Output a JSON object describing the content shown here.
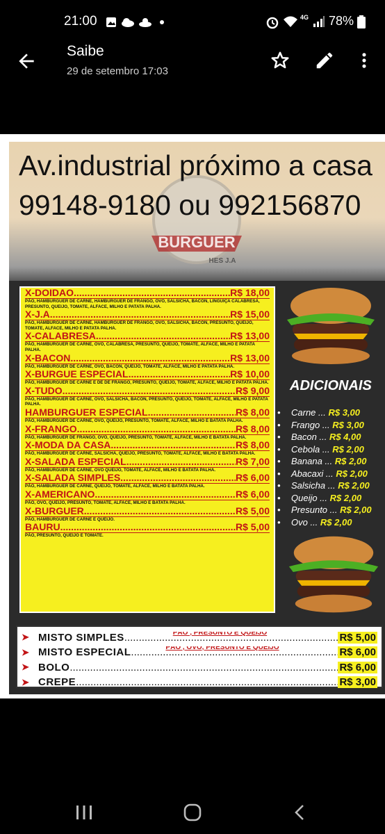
{
  "status_bar": {
    "time": "21:00",
    "network": "4G",
    "battery": "78%",
    "icons": [
      "image-icon",
      "cloud-icon",
      "weather-icon",
      "dot-icon",
      "alarm-icon",
      "wifi-icon",
      "signal-icon",
      "battery-icon"
    ]
  },
  "app_bar": {
    "title": "Saibe",
    "subtitle": "29 de setembro 17:03",
    "actions": [
      "back-arrow-icon",
      "star-icon",
      "edit-pencil-icon",
      "more-vert-icon"
    ]
  },
  "poster": {
    "address_text": "Av.industrial próximo a casa 99148-9180 ou 992156870",
    "logo_text": "BURGUER",
    "logo_subtext": "HES J.A",
    "menu_items": [
      {
        "name": "X-DOIDAO",
        "price": "R$ 18,00",
        "desc": "PÃO, HAMBURGUER DE CARNE, HAMBURGUER DE FRANGO, OVO, SALSICHA, BACON, LINGUIÇA CALABRESA, PRESUNTO, QUEIJO, TOMATE, ALFACE, MILHO E PATATA PALHA."
      },
      {
        "name": "X-J.A",
        "price": "R$ 15,00",
        "desc": "PÃO, HAMBURGUER DE CARNE, HAMBURGUER DE FRANGO, OVO, SALSICHA, BACON, PRESUNTO, QUEIJO, TOMATE, ALFACE, MILHO E PATATA PALHA."
      },
      {
        "name": "X-CALABRESA",
        "price": "R$ 13,00",
        "desc": "PÃO, HAMBURGUER DE CARNE, OVO, CALABRESA, PRESUNTO, QUEIJO, TOMATE, ALFACE, MILHO E PATATA PALHA."
      },
      {
        "name": "X-BACON",
        "price": "R$ 13,00",
        "desc": "PÃO, HAMBURGUER DE CARNE, OVO, BACON, QUEIJO, TOMATE, ALFACE, MILHO E PATATA PALHA."
      },
      {
        "name": "X-BURGUE ESPECIAL",
        "price": "R$ 10,00",
        "desc": "PÃO, HAMBURGUER DE CARNE E DE DE FRANGO, PRESUNTO, QUEIJO, TOMATE, ALFACE, MILHO E PATATA PALHA."
      },
      {
        "name": "X-TUDO",
        "price": "R$ 9,00",
        "desc": "PÃO, HAMBURGUER DE CARNE, OVO, SALSICHA, BACON, PRESUNTO, QUEIJO, TOMATE, ALFACE, MILHO E PATATA PALHA."
      },
      {
        "name": "HAMBURGUER ESPECIAL",
        "price": "R$ 8,00",
        "desc": "PÃO, HAMBURGUER DE CARNE, OVO, QUEIJO, PRESUNTO, TOMATE, ALFACE, MILHO E BATATA PALHA."
      },
      {
        "name": "X-FRANGO",
        "price": "R$ 8,00",
        "desc": "PÃO, HAMBURGUER DE FRANGO, OVO, QUEIJO, PRESUNTO, TOMATE, ALFACE, MILHO E BATATA PALHA."
      },
      {
        "name": "X-MODA DA CASA",
        "price": "R$ 8,00",
        "desc": "PÃO, HAMBURGUER DE CARNE, SALSICHA, QUEIJO, PRESUNTO, TOMATE, ALFACE, MILHO E BATATA PALHA."
      },
      {
        "name": "X-SALADA ESPECIAL",
        "price": "R$ 7,00",
        "desc": "PÃO, HAMBURGUER DE CARNE, OVO QUEIJO, TOMATE, ALFACE, MILHO E BATATA PALHA."
      },
      {
        "name": "X-SALADA SIMPLES",
        "price": "R$ 6,00",
        "desc": "PÃO, HAMBURGUER DE CARNE, QUEIJO, TOMATE, ALFACE, MILHO E BATATA PALHA."
      },
      {
        "name": "X-AMERICANO",
        "price": "R$ 6,00",
        "desc": "PÃO, OVO, QUEIJO, PRESUNTO, TOMATE, ALFACE, MILHO E BATATA PALHA."
      },
      {
        "name": "X-BURGUER",
        "price": "R$ 5,00",
        "desc": "PÃO, HAMBURGUER DE CARNE E QUEIJO."
      },
      {
        "name": "BAURU",
        "price": "R$ 5,00",
        "desc": "PÃO, PRESUNTO, QUEIJO E TOMATE."
      }
    ],
    "adicionais_title": "ADICIONAIS",
    "adicionais": [
      {
        "name": "Carne",
        "price": "R$ 3,00"
      },
      {
        "name": "Frango",
        "price": "R$ 3,00"
      },
      {
        "name": "Bacon",
        "price": "R$ 4,00"
      },
      {
        "name": "Cebola",
        "price": "R$ 2,00"
      },
      {
        "name": "Banana",
        "price": "R$ 2,00"
      },
      {
        "name": "Abacaxi",
        "price": "R$ 2,00"
      },
      {
        "name": "Salsicha",
        "price": "R$ 2,00"
      },
      {
        "name": "Queijo",
        "price": "R$ 2,00"
      },
      {
        "name": "Presunto",
        "price": "R$ 2,00"
      },
      {
        "name": "Ovo",
        "price": "R$ 2,00"
      }
    ],
    "extra_sep": "...",
    "bottom_items": [
      {
        "name": "MISTO SIMPLES",
        "note": "PÃO , PRESUNTO E QUEIJO",
        "price": "R$ 5,00"
      },
      {
        "name": "MISTO ESPECIAL",
        "note": "PÃO , OVO, PRESUNTO E QUEIJO",
        "price": "R$ 6,00"
      },
      {
        "name": "BOLO",
        "note": "",
        "price": "R$ 6,00"
      },
      {
        "name": "CREPE",
        "note": "",
        "price": "R$ 3,00"
      }
    ]
  },
  "colors": {
    "poster_yellow": "#f6ef1f",
    "poster_red": "#c21416",
    "poster_dark": "#2b2b2b"
  },
  "nav_bar": {
    "icons": [
      "recents-icon",
      "home-icon",
      "back-icon"
    ]
  }
}
